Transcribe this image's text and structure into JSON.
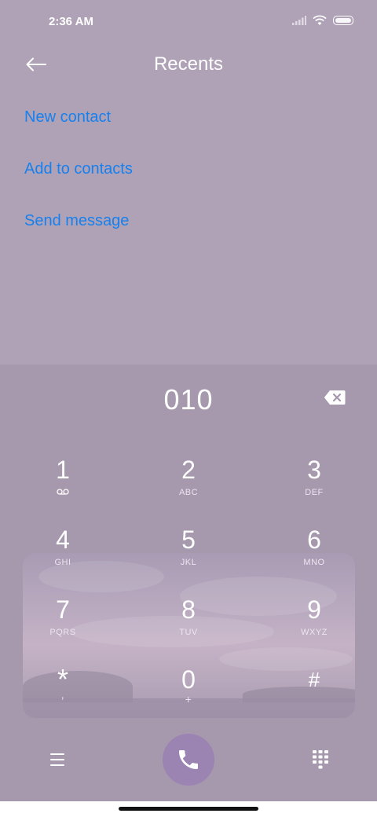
{
  "status_bar": {
    "time": "2:36 AM",
    "icons": [
      "signal-icon",
      "wifi-icon",
      "battery-icon"
    ]
  },
  "header": {
    "title": "Recents",
    "back_icon": "arrow-left-icon"
  },
  "menu": {
    "items": [
      {
        "label": "New contact"
      },
      {
        "label": "Add to contacts"
      },
      {
        "label": "Send message"
      }
    ]
  },
  "dialer": {
    "number": "010",
    "backspace_icon": "backspace-icon",
    "keys": [
      {
        "digit": "1",
        "letters": ""
      },
      {
        "digit": "2",
        "letters": "ABC"
      },
      {
        "digit": "3",
        "letters": "DEF"
      },
      {
        "digit": "4",
        "letters": "GHI"
      },
      {
        "digit": "5",
        "letters": "JKL"
      },
      {
        "digit": "6",
        "letters": "MNO"
      },
      {
        "digit": "7",
        "letters": "PQRS"
      },
      {
        "digit": "8",
        "letters": "TUV"
      },
      {
        "digit": "9",
        "letters": "WXYZ"
      },
      {
        "digit": "*",
        "letters": ","
      },
      {
        "digit": "0",
        "letters": "+"
      },
      {
        "digit": "#",
        "letters": ""
      }
    ]
  },
  "bottom_bar": {
    "menu_icon": "hamburger-menu-icon",
    "call_icon": "phone-icon",
    "keypad_icon": "dialpad-icon"
  },
  "colors": {
    "background": "#b0a2b6",
    "link": "#1580ee",
    "call_button": "#9b83b2"
  }
}
